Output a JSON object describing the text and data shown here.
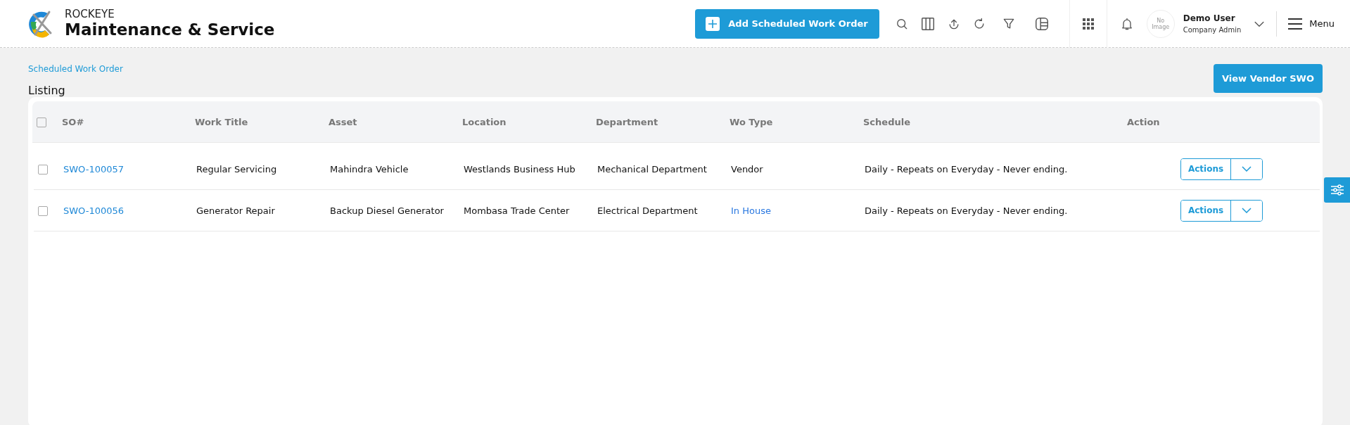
{
  "app": {
    "brand": "ROCKEYE",
    "title": "Maintenance & Service"
  },
  "toolbar": {
    "add_button": "Add Scheduled Work Order"
  },
  "user": {
    "avatar_text": "No Image",
    "name": "Demo User",
    "role": "Company Admin"
  },
  "menu_label": "Menu",
  "breadcrumb": "Scheduled Work Order",
  "page_title": "Listing",
  "view_vendor_button": "View Vendor SWO",
  "table": {
    "select_all_checked": false,
    "columns": [
      "SO#",
      "Work Title",
      "Asset",
      "Location",
      "Department",
      "Wo Type",
      "Schedule",
      "Action"
    ],
    "rows": [
      {
        "checked": false,
        "so": "SWO-100057",
        "work_title": "Regular Servicing",
        "asset": "Mahindra Vehicle",
        "location": "Westlands Business Hub",
        "department": "Mechanical Department",
        "wo_type": "Vendor",
        "kind": "text",
        "schedule": "Daily - Repeats on Everyday - Never ending.",
        "action": "Actions"
      },
      {
        "checked": false,
        "so": "SWO-100056",
        "work_title": "Generator Repair",
        "asset": "Backup Diesel Generator",
        "location": "Mombasa Trade Center",
        "department": "Electrical Department",
        "wo_type": "In House",
        "kind": "link",
        "schedule": "Daily - Repeats on Everyday - Never ending.",
        "action": "Actions"
      }
    ]
  }
}
